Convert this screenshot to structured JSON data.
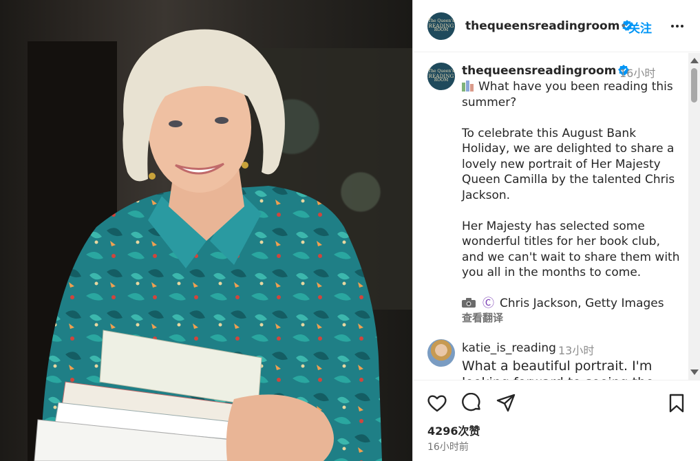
{
  "photo": {
    "alt_icon": "portrait-photo"
  },
  "post": {
    "avatar_text": [
      "The Queen's",
      "READING",
      "ROOM"
    ],
    "username": "thequeensreadingroom",
    "separator": "•",
    "follow_label": "关注",
    "caption": {
      "time": "16小时",
      "line1": "What have you been reading this summer?",
      "para2": "To celebrate this August Bank Holiday, we are delighted to share a lovely new portrait of Her Majesty Queen Camilla by the talented Chris Jackson.",
      "para3": "Her Majesty has selected some wonderful titles for her book club, and we can't wait to share them with you all in the months to come.",
      "credit_symbol": "Ⓒ",
      "credit": "Chris Jackson, Getty Images",
      "translate_label": "查看翻译"
    },
    "comment": {
      "username": "katie_is_reading",
      "time": "13小时",
      "text": "What a beautiful portrait. I'm looking forward to seeing the"
    },
    "likes": "4296次赞",
    "posted_time": "16小时前",
    "colors": {
      "accent": "#0095f6",
      "verified": "#0095f6",
      "muted": "#737373",
      "avatar_bg": "#1f4a5c"
    }
  }
}
